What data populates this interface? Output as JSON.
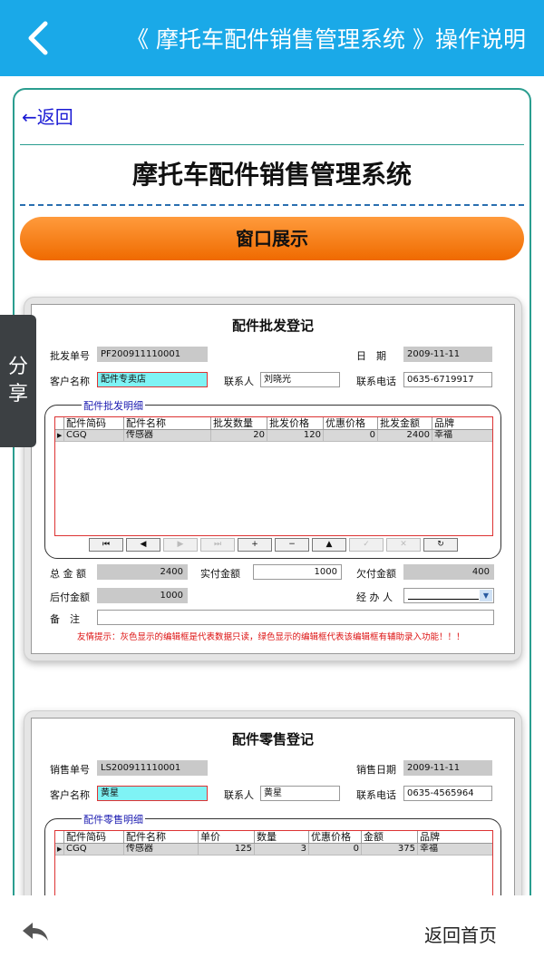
{
  "header": {
    "title": "《 摩托车配件销售管理系统 》操作说明"
  },
  "content": {
    "back_link": "←返回",
    "system_title": "摩托车配件销售管理系统",
    "section_label": "窗口展示"
  },
  "share": {
    "line1": "分",
    "line2": "享"
  },
  "wholesale_form": {
    "title": "配件批发登记",
    "order_no_label": "批发单号",
    "order_no": "PF200911110001",
    "date_label": "日　期",
    "date": "2009-11-11",
    "customer_label": "客户名称",
    "customer": "配件专卖店",
    "contact_label": "联系人",
    "contact": "刘晓光",
    "phone_label": "联系电话",
    "phone": "0635-6719917",
    "group_title": "配件批发明细",
    "columns": [
      "配件简码",
      "配件名称",
      "批发数量",
      "批发价格",
      "优惠价格",
      "批发金额",
      "品牌"
    ],
    "row": [
      "CGQ",
      "传感器",
      "20",
      "120",
      "0",
      "2400",
      "幸福"
    ],
    "nav_buttons": [
      "⏮",
      "◀",
      "▶",
      "⏭",
      "+",
      "−",
      "▲",
      "✓",
      "✕",
      "↻"
    ],
    "total_label": "总 金 额",
    "total": "2400",
    "paid_label": "实付金额",
    "paid": "1000",
    "owed_label": "欠付金额",
    "owed": "400",
    "later_label": "后付金额",
    "later": "1000",
    "handler_label": "经 办 人",
    "remark_label": "备　注",
    "tip": "友情提示：灰色显示的编辑框是代表数据只读，绿色显示的编辑框代表该编辑框有辅助录入功能！！！"
  },
  "retail_form": {
    "title": "配件零售登记",
    "order_no_label": "销售单号",
    "order_no": "LS200911110001",
    "date_label": "销售日期",
    "date": "2009-11-11",
    "customer_label": "客户名称",
    "customer": "黄星",
    "contact_label": "联系人",
    "contact": "黄星",
    "phone_label": "联系电话",
    "phone": "0635-4565964",
    "group_title": "配件零售明细",
    "columns": [
      "配件简码",
      "配件名称",
      "单价",
      "数量",
      "优惠价格",
      "金额",
      "品牌"
    ],
    "row": [
      "CGQ",
      "传感器",
      "125",
      "3",
      "0",
      "375",
      "幸福"
    ]
  },
  "footer": {
    "home_label": "返回首页"
  }
}
